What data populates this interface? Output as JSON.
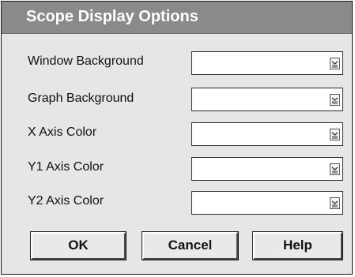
{
  "dialog": {
    "title": "Scope Display Options"
  },
  "fields": [
    {
      "label": "Window Background",
      "value": ""
    },
    {
      "label": "Graph Background",
      "value": ""
    },
    {
      "label": "X Axis Color",
      "value": ""
    },
    {
      "label": "Y1 Axis Color",
      "value": ""
    },
    {
      "label": "Y2 Axis Color",
      "value": ""
    }
  ],
  "buttons": {
    "ok_label": "OK",
    "cancel_label": "Cancel",
    "help_label": "Help"
  },
  "icons": {
    "dropdown": "chevron-down-icon"
  }
}
